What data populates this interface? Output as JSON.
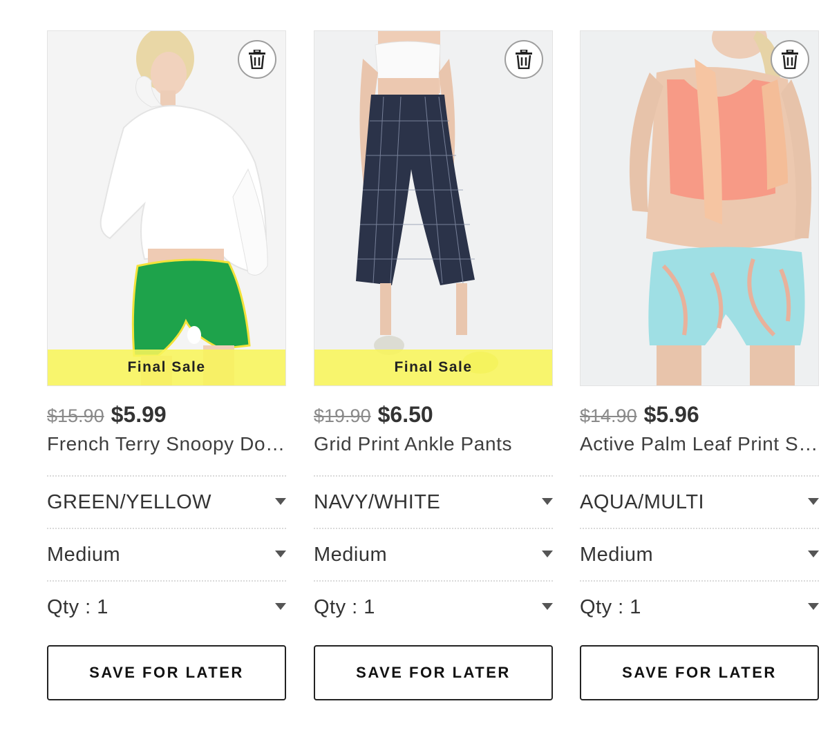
{
  "products": [
    {
      "original_price": "$15.90",
      "sale_price": "$5.99",
      "name": "French Terry Snoopy Dolphin Shorts",
      "badge": "Final Sale",
      "color_option": "GREEN/YELLOW",
      "size_option": "Medium",
      "qty_option": "Qty : 1",
      "save_label": "SAVE FOR LATER"
    },
    {
      "original_price": "$19.90",
      "sale_price": "$6.50",
      "name": "Grid Print Ankle Pants",
      "badge": "Final Sale",
      "color_option": "NAVY/WHITE",
      "size_option": "Medium",
      "qty_option": "Qty : 1",
      "save_label": "SAVE FOR LATER"
    },
    {
      "original_price": "$14.90",
      "sale_price": "$5.96",
      "name": "Active Palm Leaf Print Shorts",
      "color_option": "AQUA/MULTI",
      "size_option": "Medium",
      "qty_option": "Qty : 1",
      "save_label": "SAVE FOR LATER"
    }
  ],
  "icons": {
    "remove": "trash-icon",
    "dropdown": "caret-down-icon"
  },
  "colors": {
    "final_sale_banner": "#f8f55a",
    "strikethrough_price": "#8a8a8a",
    "button_border": "#222222"
  }
}
